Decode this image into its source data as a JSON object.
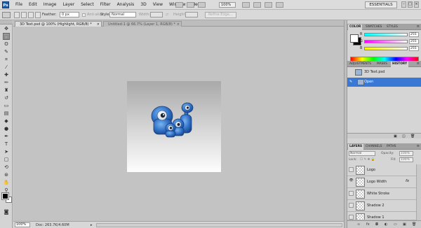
{
  "app": {
    "logo": "Ps"
  },
  "menu": [
    "File",
    "Edit",
    "Image",
    "Layer",
    "Select",
    "Filter",
    "Analysis",
    "3D",
    "View",
    "Window",
    "Help"
  ],
  "appbar": {
    "zoom": "100%",
    "workspace": "ESSENTIALS"
  },
  "options": {
    "feather_label": "Feather:",
    "feather_value": "0 px",
    "antialias_label": "Anti-alias",
    "style_label": "Style:",
    "style_value": "Normal",
    "width_label": "Width:",
    "height_label": "Height:",
    "refine_edge": "Refine Edge..."
  },
  "document": {
    "tabs": [
      {
        "label": "3D Text.psd @ 100% (Highlight, RGB/8) *",
        "close": "×"
      },
      {
        "label": "Untitled-1 @ 66.7% (Layer 1, RGB/8) *",
        "close": "×"
      }
    ],
    "zoom": "100%",
    "doc_info": "Doc: 263.7K/4.60M"
  },
  "panels": {
    "color_tabs": [
      "COLOR",
      "SWATCHES",
      "STYLES"
    ],
    "color_channels": [
      {
        "label": "R",
        "value": "255"
      },
      {
        "label": "G",
        "value": "255"
      },
      {
        "label": "B",
        "value": "255"
      }
    ],
    "history_tabs": [
      "ADJUSTMENTS",
      "MASKS",
      "HISTORY"
    ],
    "history": [
      {
        "label": "3D Text.psd"
      },
      {
        "label": "Open"
      }
    ],
    "layers_tabs": [
      "LAYERS",
      "CHANNELS",
      "PATHS"
    ],
    "layers": {
      "blend_mode": "Normal",
      "opacity_label": "Opacity:",
      "opacity_value": "100%",
      "lock_label": "Lock:",
      "fill_label": "Fill:",
      "fill_value": "100%",
      "items": [
        {
          "name": "Logo",
          "fx": ""
        },
        {
          "name": "Logo Width",
          "fx": "fx"
        },
        {
          "name": "White Stroke",
          "fx": ""
        },
        {
          "name": "Shadow 2",
          "fx": ""
        },
        {
          "name": "Shadow 1",
          "fx": ""
        }
      ]
    }
  },
  "colors": {
    "accent": "#3a78d6",
    "menubar": "#dcdcdc",
    "canvas_bg": "#c3c3c3"
  }
}
